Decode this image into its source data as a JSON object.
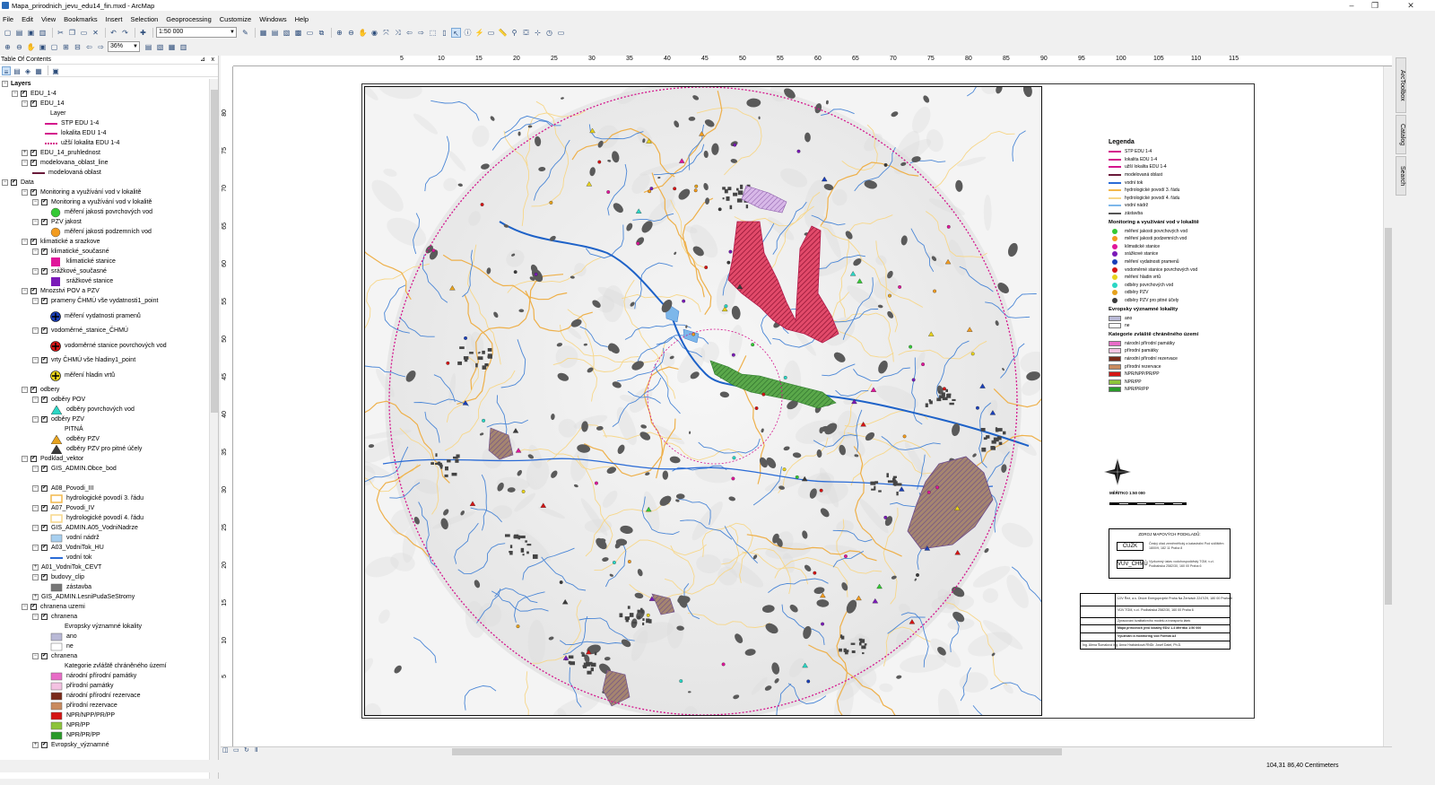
{
  "window": {
    "title": "Mapa_prirodnich_jevu_edu14_fin.mxd - ArcMap",
    "minimize_glyph": "–",
    "restore_glyph": "❐",
    "close_glyph": "✕"
  },
  "menu": [
    "File",
    "Edit",
    "View",
    "Bookmarks",
    "Insert",
    "Selection",
    "Geoprocessing",
    "Customize",
    "Windows",
    "Help"
  ],
  "toolbar": {
    "scale_value": "1:50 000",
    "zoom_value": "36%"
  },
  "toc": {
    "title": "Table Of Contents",
    "pin": "⊿",
    "close": "x",
    "items": [
      {
        "label": "Layers",
        "bold": true
      },
      {
        "label": "EDU_1-4"
      },
      {
        "label": "EDU_14"
      },
      {
        "label": "Layer"
      },
      {
        "label": "STP EDU 1-4"
      },
      {
        "label": "lokalita EDU 1-4"
      },
      {
        "label": "užší lokalita EDU 1-4"
      },
      {
        "label": "EDU_14_pruhlednost"
      },
      {
        "label": "modelovana_oblast_line"
      },
      {
        "label": "modelovaná oblast"
      },
      {
        "label": "Data"
      },
      {
        "label": "Monitoring a využívání vod v lokalitě"
      },
      {
        "label": "Monitoring a využívání vod v lokalitě"
      },
      {
        "label": "měření jakosti povrchových vod"
      },
      {
        "label": "PZV jakost"
      },
      {
        "label": "měření jakosti podzemních vod"
      },
      {
        "label": "klimatické a srazkove"
      },
      {
        "label": "klimatické_současné"
      },
      {
        "label": "klimatické stanice"
      },
      {
        "label": "srážkové_současné"
      },
      {
        "label": "srážkové stanice"
      },
      {
        "label": "Mnozstvi POV a PZV"
      },
      {
        "label": "prameny ČHMÚ vše vydatnosti1_point"
      },
      {
        "label": "měření vydatnosti pramenů"
      },
      {
        "label": "vodoměrné_stanice_ČHMÚ"
      },
      {
        "label": "vodoměrné stanice povrchových vod"
      },
      {
        "label": "vrty ČHMÚ vše hladiny1_point"
      },
      {
        "label": "měření hladin vrtů"
      },
      {
        "label": "odbery"
      },
      {
        "label": "odběry POV"
      },
      {
        "label": "odběry povrchových vod"
      },
      {
        "label": "odběry PZV"
      },
      {
        "label": "PITNÁ"
      },
      {
        "label": "odběry PZV"
      },
      {
        "label": "odběry PZV pro pitné účely"
      },
      {
        "label": "Podklad_vektor"
      },
      {
        "label": "GIS_ADMIN.Obce_bod"
      },
      {
        "label": "A08_Povodi_III"
      },
      {
        "label": "hydrologické povodí 3. řádu"
      },
      {
        "label": "A07_Povodi_IV"
      },
      {
        "label": "hydrologické povodí 4. řádu"
      },
      {
        "label": "GIS_ADMIN.A05_VodniNadrze"
      },
      {
        "label": "vodní nádrž"
      },
      {
        "label": "A03_VodniTok_HU"
      },
      {
        "label": "vodní tok"
      },
      {
        "label": "A01_VodniTok_CEVT"
      },
      {
        "label": "budovy_clip"
      },
      {
        "label": "zástavba"
      },
      {
        "label": "GIS_ADMIN.LesniPudaSeStromy"
      },
      {
        "label": "chranena uzemi"
      },
      {
        "label": "chranena"
      },
      {
        "label": "Evropsky významné lokality"
      },
      {
        "label": "ano"
      },
      {
        "label": "ne"
      },
      {
        "label": "chranena"
      },
      {
        "label": "Kategorie zvláště chráněného území"
      },
      {
        "label": "národní přírodní památky"
      },
      {
        "label": "přírodní památky"
      },
      {
        "label": "národní přírodní rezervace"
      },
      {
        "label": "přírodní rezervace"
      },
      {
        "label": "NPR/NPP/PR/PP"
      },
      {
        "label": "NPR/PP"
      },
      {
        "label": "NPR/PR/PP"
      },
      {
        "label": "Evropsky_významné"
      }
    ]
  },
  "rulers": {
    "h": [
      "5",
      "10",
      "15",
      "20",
      "25",
      "30",
      "35",
      "40",
      "45",
      "50",
      "55",
      "60",
      "65",
      "70",
      "75",
      "80",
      "85",
      "90",
      "95",
      "100",
      "105",
      "110",
      "115"
    ],
    "v": [
      "80",
      "75",
      "70",
      "65",
      "60",
      "55",
      "50",
      "45",
      "40",
      "35",
      "30",
      "25",
      "20",
      "15",
      "10",
      "5"
    ]
  },
  "legend": {
    "title": "Legenda",
    "items": [
      {
        "label": "STP EDU 1-4",
        "color": "#d4148c"
      },
      {
        "label": "lokalita EDU 1-4",
        "color": "#d4148c"
      },
      {
        "label": "užší lokalita EDU 1-4",
        "color": "#d4148c"
      },
      {
        "label": "modelovaná oblast",
        "color": "#6a1a3a"
      },
      {
        "label": "vodní tok",
        "color": "#2a6bd6"
      },
      {
        "label": "hydrologické povodí 3. řádu",
        "color": "#f2b84b"
      },
      {
        "label": "hydrologické povodí 4. řádu",
        "color": "#f7d78a"
      },
      {
        "label": "vodní nádrž",
        "color": "#7db7ea"
      },
      {
        "label": "zástavba",
        "color": "#555555"
      }
    ],
    "monitoring_head": "Monitoring a využívání vod v lokalitě",
    "monitoring": [
      {
        "label": "měření jakosti povrchových vod",
        "color": "#34c934"
      },
      {
        "label": "měření jakosti podzemních vod",
        "color": "#f29b1e"
      },
      {
        "label": "klimatické stanice",
        "color": "#e0169a"
      },
      {
        "label": "srážkové stanice",
        "color": "#7a1ab8"
      },
      {
        "label": "měření vydatnosti pramenů",
        "color": "#1a3fb8"
      },
      {
        "label": "vodoměrné stanice povrchových vod",
        "color": "#d41414"
      },
      {
        "label": "měření hladin vrtů",
        "color": "#e8d21a"
      },
      {
        "label": "odběry povrchových vod",
        "color": "#2ad6c4"
      },
      {
        "label": "odběry PZV",
        "color": "#e6a21e"
      },
      {
        "label": "odběry PZV pro pitné účely",
        "color": "#3a3a3a"
      }
    ],
    "evl_head": "Evropsky významné lokality",
    "evl": [
      {
        "label": "ano",
        "color": "#b9b9d6"
      },
      {
        "label": "ne",
        "color": "#ffffff"
      }
    ],
    "kat_head": "Kategorie zvláště chráněného území",
    "kat": [
      {
        "label": "národní přírodní památky",
        "color": "#e86cc7"
      },
      {
        "label": "přírodní památky",
        "color": "#f4c2e2"
      },
      {
        "label": "národní přírodní rezervace",
        "color": "#7a2a1a"
      },
      {
        "label": "přírodní rezervace",
        "color": "#c98a5e"
      },
      {
        "label": "NPR/NPP/PR/PP",
        "color": "#d41414"
      },
      {
        "label": "NPR/PP",
        "color": "#8cc43a"
      },
      {
        "label": "NPR/PR/PP",
        "color": "#2a9a2a"
      }
    ],
    "scale_label": "MĚŘÍTKO 1:50 000"
  },
  "sources": {
    "heading": "ZDROJ MAPOVÝCH PODKLADŮ:",
    "rows": [
      {
        "btn": "ČÚZK",
        "text": "Český úřad zeměměřický a katastrální Pod sídlištěm 1800/9, 182 11 Praha 8"
      },
      {
        "btn": "VÚV_ČHMÚ",
        "text": "Výzkumný ústav vodohospodářský TGM, v.v.i. Podbabská 2582/30, 160 00 Praha 6"
      }
    ]
  },
  "titleblock": {
    "rows": [
      "ÚJV Řež, a.s.   Divize Energoprojekt Praha   Na Žertvách 2247/29, 180 00 Praha 8",
      "VÚV TGM, v.v.i.   Podbabská 2582/30, 160 00 Praha 6",
      "Zpracování kvalitativního modelu a transportu látek",
      "Mapa přírodních jevů lokality   EDU 1-4   Měřítko 1:50 000",
      "Využívání a monitoring vod   Formát A3",
      "Ing. Alena Šumalová   Ing. Anna Hrabánková   RNDr. Josef Datel, Ph.D."
    ]
  },
  "sidetabs": [
    "ArcToolbox",
    "Catalog",
    "Search"
  ],
  "status": {
    "coords": "104,31  86,40 Centimeters"
  }
}
